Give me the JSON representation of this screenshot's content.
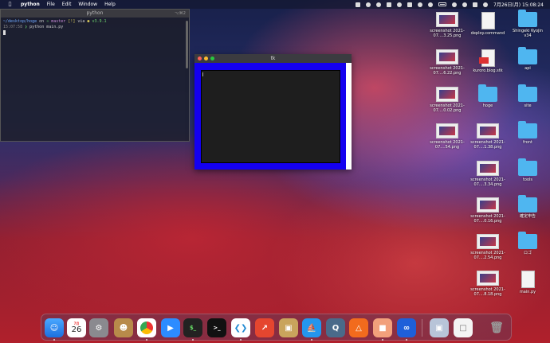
{
  "menubar": {
    "app_name": "python",
    "menus": [
      "File",
      "Edit",
      "Window",
      "Help"
    ],
    "datetime": "7月26日(月) 15:08:24"
  },
  "terminal": {
    "title": "python",
    "shortcut": "⌥⌘2",
    "lines": {
      "path": "~/desktop/hoge",
      "on": "on",
      "branch": "master",
      "status": "[!]",
      "via": "via",
      "version": "v3.9.1",
      "time": "15:07:58",
      "command": "python main.py"
    }
  },
  "tk_window": {
    "title": "tk"
  },
  "desktop_icons": [
    {
      "label": "screenshot 2021-07....3.25.png",
      "kind": "shot"
    },
    {
      "label": "deploy.command",
      "kind": "doc"
    },
    {
      "label": "Shingeki Kyojin v34",
      "kind": "folder"
    },
    {
      "label": "screenshot 2021-07....6.22.png",
      "kind": "shot"
    },
    {
      "label": "kuroro.blog.stk",
      "kind": "doc"
    },
    {
      "label": "api",
      "kind": "folder"
    },
    {
      "label": "screenshot 2021-07....0.02.png",
      "kind": "shot"
    },
    {
      "label": "hoge",
      "kind": "folder"
    },
    {
      "label": "site",
      "kind": "folder"
    },
    {
      "label": "screenshot 2021-07....54.png",
      "kind": "shot"
    },
    {
      "label": "screenshot 2021-07....1.38.png",
      "kind": "shot"
    },
    {
      "label": "front",
      "kind": "folder"
    },
    {
      "label": "screenshot 2021-07....3.34.png",
      "kind": "shot"
    },
    {
      "label": "tools",
      "kind": "folder"
    },
    {
      "label": "screenshot 2021-07....0.16.png",
      "kind": "shot"
    },
    {
      "label": "確定申告",
      "kind": "folder"
    },
    {
      "label": "screenshot 2021-07....2.54.png",
      "kind": "shot"
    },
    {
      "label": "ロゴ",
      "kind": "folder"
    },
    {
      "label": "screenshot 2021-07....8.18.png",
      "kind": "shot"
    },
    {
      "label": "main.py",
      "kind": "doc"
    }
  ],
  "dock": {
    "calendar_month": "7月",
    "calendar_day": "26"
  }
}
